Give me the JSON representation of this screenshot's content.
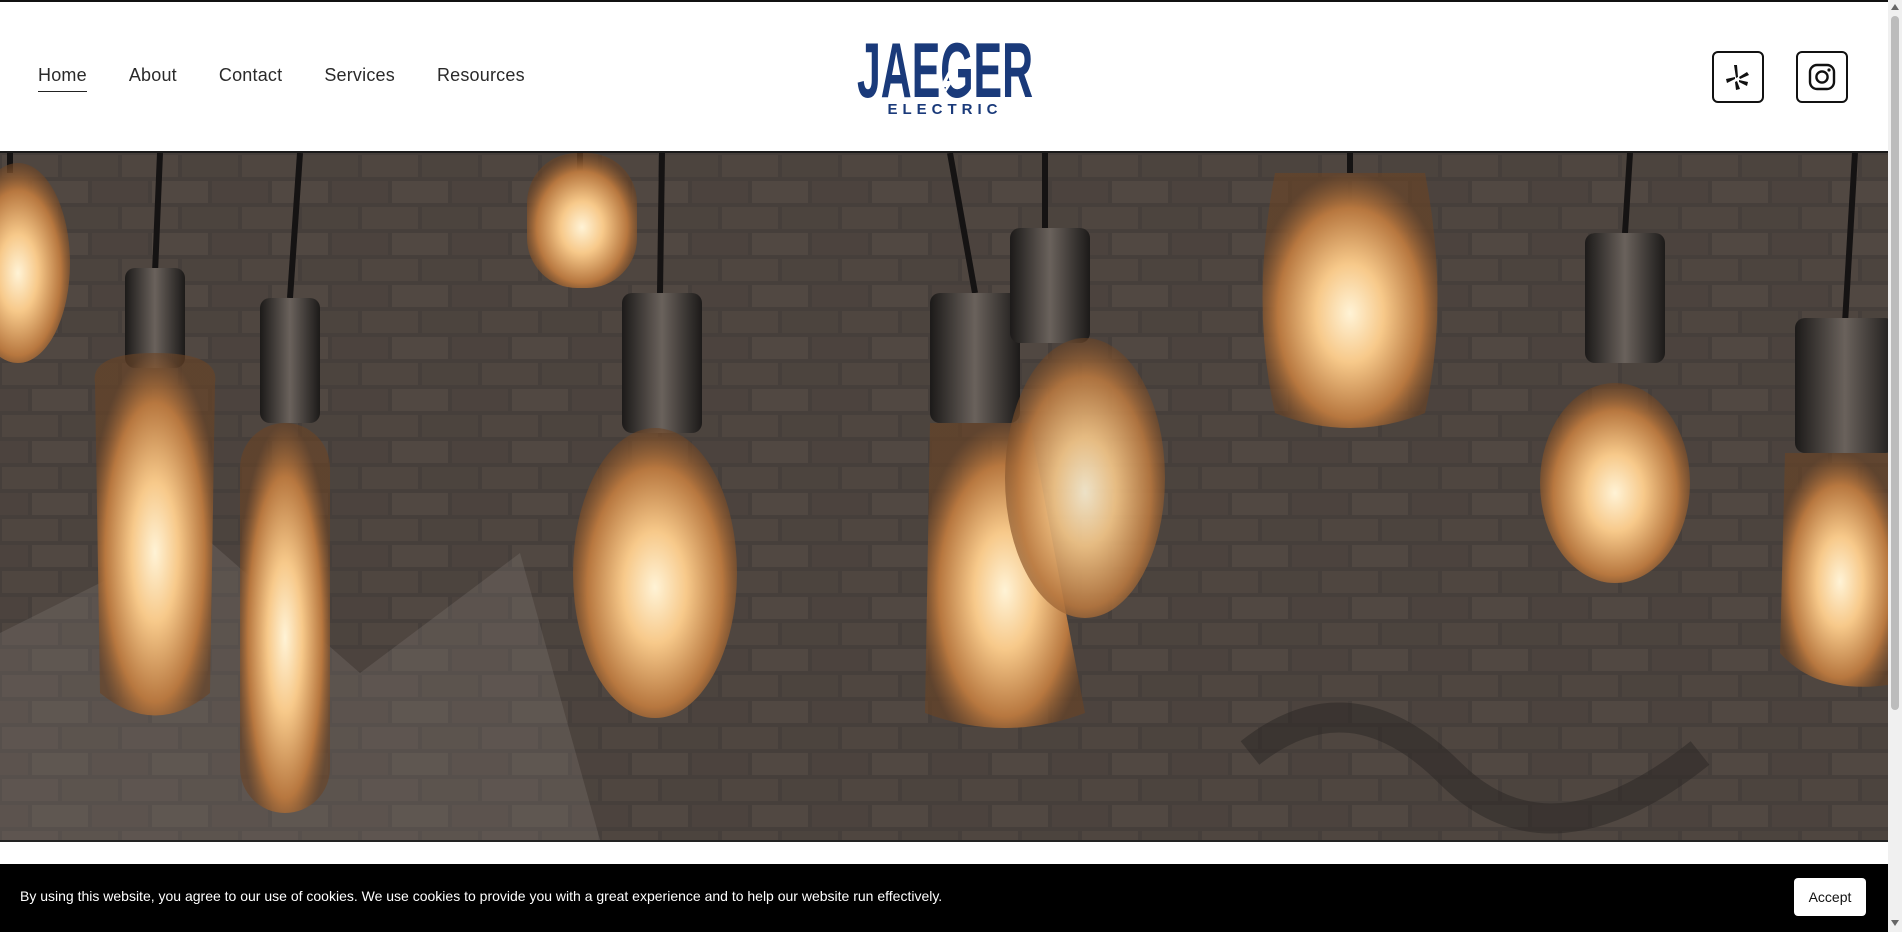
{
  "nav": {
    "items": [
      {
        "label": "Home",
        "active": true
      },
      {
        "label": "About"
      },
      {
        "label": "Contact"
      },
      {
        "label": "Services"
      },
      {
        "label": "Resources"
      }
    ]
  },
  "logo": {
    "name": "JAEGER",
    "sub": "ELECTRIC",
    "color": "#1a3a7a"
  },
  "social": [
    {
      "icon": "yelp-icon"
    },
    {
      "icon": "instagram-icon"
    }
  ],
  "hero": {
    "image": "hanging-edison-bulbs-brick-wall"
  },
  "cookie": {
    "text": "By using this website, you agree to our use of cookies. We use cookies to provide you with a great experience and to help our website run effectively.",
    "accept_label": "Accept"
  }
}
